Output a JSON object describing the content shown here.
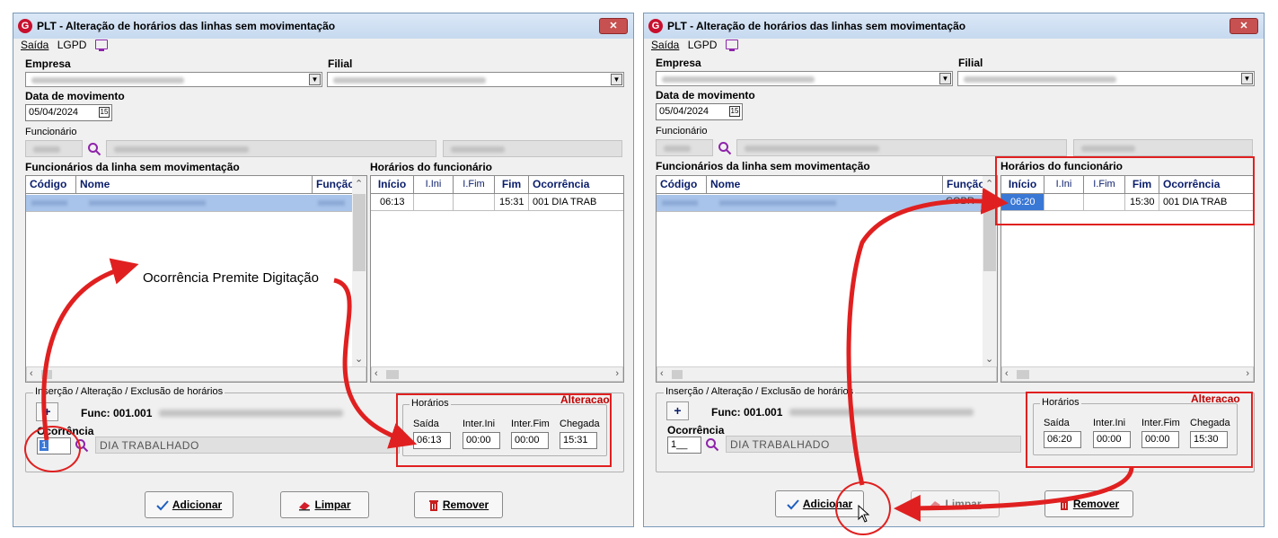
{
  "window": {
    "title": "PLT - Alteração de horários das linhas sem movimentação",
    "close_glyph": "✕"
  },
  "menu": {
    "saida": "Saída",
    "lgpd": "LGPD"
  },
  "labels": {
    "empresa": "Empresa",
    "filial": "Filial",
    "data_movimento": "Data de movimento",
    "funcionario": "Funcionário",
    "func_linha": "Funcionários da linha sem movimentação",
    "horarios_func": "Horários do funcionário",
    "insercao": "Inserção / Alteração / Exclusão de horários",
    "alteracao": "Alteracao",
    "horarios": "Horários",
    "ocorrencia": "Ocorrência",
    "saida": "Saída",
    "inter_ini": "Inter.Ini",
    "inter_fim": "Inter.Fim",
    "chegada": "Chegada"
  },
  "left_grid_headers": {
    "codigo": "Código",
    "nome": "Nome",
    "funcao": "Função"
  },
  "right_grid_headers": {
    "inicio": "Início",
    "iini": "I.Ini",
    "ifim": "I.Fim",
    "fim": "Fim",
    "ocorrencia": "Ocorrência"
  },
  "buttons": {
    "adicionar": "Adicionar",
    "limpar": "Limpar",
    "remover": "Remover",
    "plus": "+"
  },
  "panel_left": {
    "date": "05/04/2024",
    "func_label": "Func: 001.001",
    "row": {
      "inicio": "06:13",
      "iini": "",
      "ifim": "",
      "fim": "15:31",
      "ocorrencia": "001 DIA TRAB"
    },
    "ocorrencia_code": "1",
    "ocorrencia_desc": "DIA TRABALHADO",
    "saida": "06:13",
    "inter_ini": "00:00",
    "inter_fim": "00:00",
    "chegada": "15:31",
    "callout": "Ocorrência Premite Digitação"
  },
  "panel_right": {
    "date": "05/04/2024",
    "func_label": "Func: 001.001",
    "row": {
      "inicio": "06:20",
      "iini": "",
      "ifim": "",
      "fim": "15:30",
      "ocorrencia": "001 DIA TRAB"
    },
    "ocorrencia_code": "1__",
    "ocorrencia_desc": "DIA TRABALHADO",
    "saida": "06:20",
    "inter_ini": "00:00",
    "inter_fim": "00:00",
    "chegada": "15:30",
    "partial_funcao": "COBR"
  },
  "colors": {
    "accent_red": "#e02020",
    "header_blue": "#0a1d6b",
    "purple_icon": "#8e24aa"
  }
}
